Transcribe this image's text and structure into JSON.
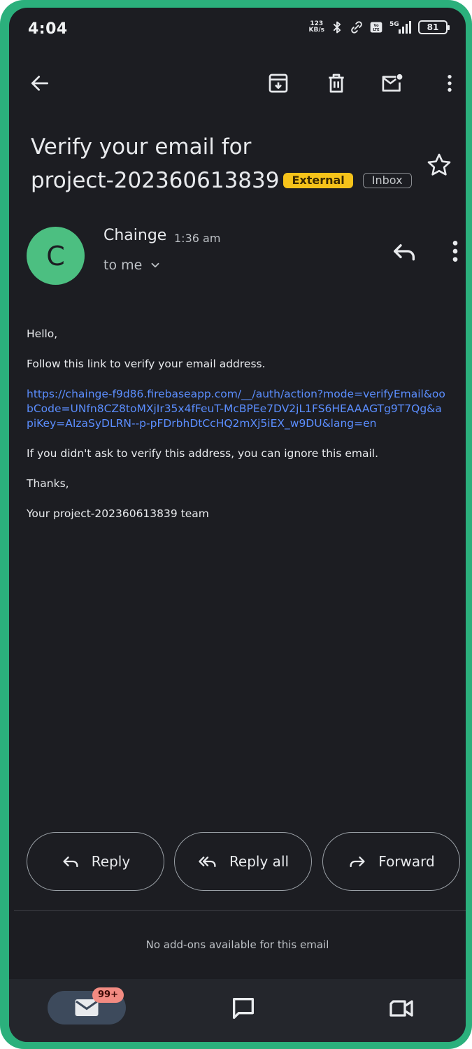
{
  "status_bar": {
    "time": "4:04",
    "speed_value": "123",
    "speed_unit": "KB/s",
    "network": "5G",
    "battery": "81"
  },
  "toolbar": {
    "icons": [
      "back-arrow-icon",
      "archive-icon",
      "delete-icon",
      "mark-unread-icon",
      "more-vert-icon"
    ]
  },
  "email": {
    "subject_line1": "Verify your email for",
    "subject_line2": "project-202360613839",
    "label_external": "External",
    "label_inbox": "Inbox",
    "sender": {
      "initial": "C",
      "name": "Chainge",
      "time": "1:36 am",
      "recipient": "to me"
    },
    "body": {
      "greeting": "Hello,",
      "instruction": "Follow this link to verify your email address.",
      "link": "https://chainge-f9d86.firebaseapp.com/__/auth/action?mode=verifyEmail&oobCode=UNfn8CZ8toMXjIr35x4fFeuT-McBPEe7DV2jL1FS6HEAAAGTg9T7Qg&apiKey=AIzaSyDLRN--p-pFDrbhDtCcHQ2mXj5iEX_w9DU&lang=en",
      "ignore_note": "If you didn't ask to verify this address, you can ignore this email.",
      "thanks": "Thanks,",
      "signature": "Your project-202360613839 team"
    }
  },
  "actions": {
    "reply": "Reply",
    "reply_all": "Reply all",
    "forward": "Forward"
  },
  "addons_text": "No add-ons available for this email",
  "bottom_nav": {
    "mail_badge": "99+"
  },
  "colors": {
    "background": "#1c1d22",
    "accent_link": "#5b8eff",
    "external_badge": "#f6c31a",
    "avatar": "#4cbf81",
    "frame": "#2bb07c"
  }
}
